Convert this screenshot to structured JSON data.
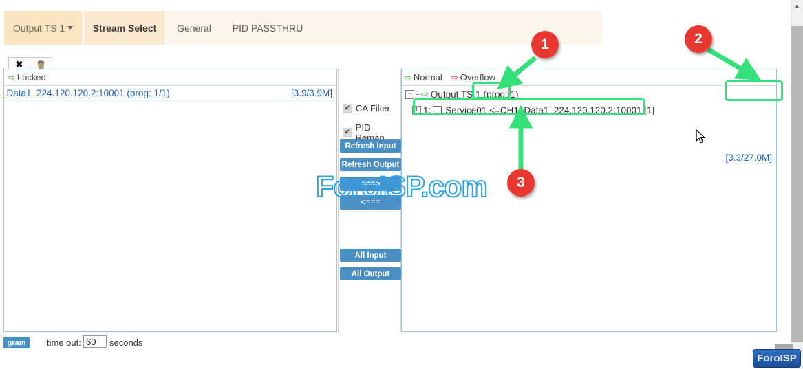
{
  "tabs": [
    {
      "label": "Output TS 1",
      "type": "dropdown",
      "icon": "chevron-down-icon"
    },
    {
      "label": "Stream Select",
      "type": "active"
    },
    {
      "label": "General",
      "type": "plain"
    },
    {
      "label": "PID PASSTHRU",
      "type": "plain"
    }
  ],
  "toolbar": {
    "close_icon": "✖",
    "close_name": "close-icon",
    "trash_icon": "🗑",
    "trash_name": "trash-icon"
  },
  "left_panel": {
    "status_arrow": "⇨",
    "status_label": "Locked",
    "streams": [
      {
        "name": "_Data1_224.120.120.2:10001 (prog: 1/1)",
        "rate": "[3.9/3.9M]"
      }
    ]
  },
  "middle": {
    "checkboxes": [
      {
        "label": "CA Filter",
        "checked": true,
        "mark": "✔"
      },
      {
        "label": "PID Remap",
        "checked": true,
        "mark": "✔"
      }
    ],
    "buttons": [
      {
        "label": "Refresh Input",
        "name": "refresh-input-button"
      },
      {
        "label": "Refresh Output",
        "name": "refresh-output-button"
      },
      {
        "label": "===>",
        "name": "move-right-button"
      },
      {
        "label": "<===",
        "name": "move-left-button"
      },
      {
        "label": "All Input",
        "name": "all-input-button"
      },
      {
        "label": "All Output",
        "name": "all-output-button"
      }
    ]
  },
  "right_panel": {
    "legend": {
      "normal_arrow": "⇨",
      "normal_label": "Normal",
      "overflow_arrow": "⇨",
      "overflow_label": "Overflow"
    },
    "tree": {
      "expander_collapse": "-",
      "root_arrow": "⇨",
      "root_label": "Output TS 1",
      "root_prog": "(prog: 1)",
      "root_rate": "[3.3/27.0M]",
      "child_expander": "+",
      "child_label": "1: ",
      "child_service": "Service01 <=CH1_Data1_224.120.120.2:10001 [1]"
    }
  },
  "bottom": {
    "program_button": "gram",
    "timeout_label": "time out:",
    "timeout_value": "60",
    "timeout_placeholder": "60",
    "seconds_label": "seconds"
  },
  "watermarks": {
    "center": "ForoISP.com",
    "badge": "ForoISP"
  },
  "annotations": {
    "callouts": [
      {
        "number": "1"
      },
      {
        "number": "2"
      },
      {
        "number": "3"
      }
    ],
    "highlight_color": "#34e07a",
    "callout_color": "#e8382f"
  },
  "scrollbar": {
    "up_arrow": "▲"
  }
}
